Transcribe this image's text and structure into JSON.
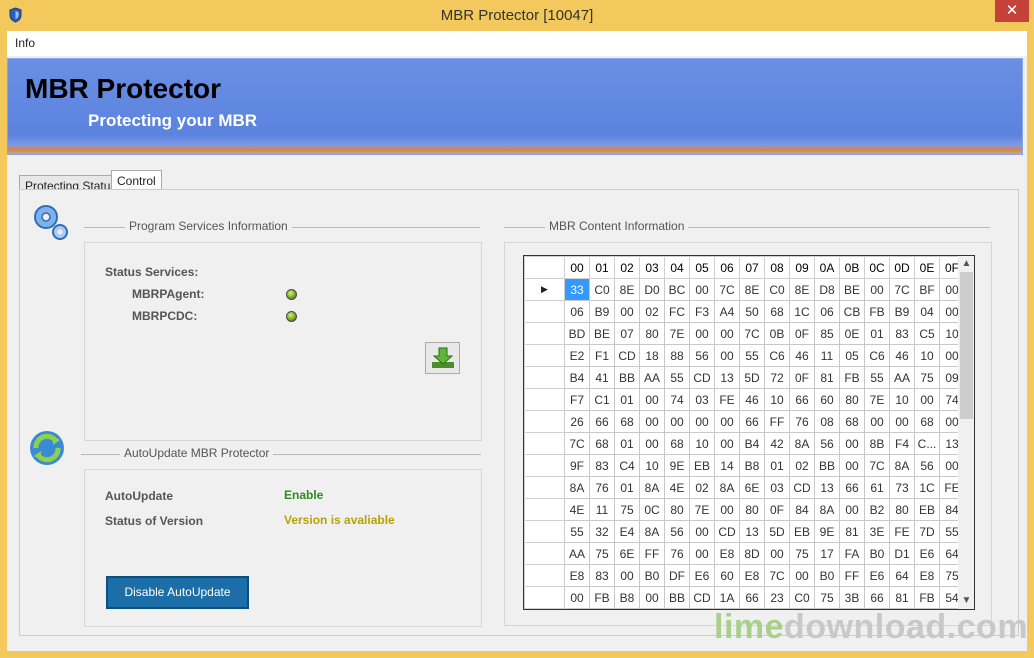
{
  "window": {
    "title": "MBR Protector [10047]",
    "close_glyph": "✕",
    "icon": "shield-icon"
  },
  "menu": {
    "items": [
      "Info"
    ]
  },
  "banner": {
    "title": "MBR Protector",
    "subtitle": "Protecting your MBR"
  },
  "tabs": [
    {
      "label": "Protecting Status",
      "active": false
    },
    {
      "label": "Control",
      "active": true
    }
  ],
  "services": {
    "group_title": "Program Services Information",
    "status_label": "Status Services:",
    "items": [
      {
        "name": "MBRPAgent:",
        "status": "running"
      },
      {
        "name": "MBRPCDC:",
        "status": "running"
      }
    ],
    "icon": "gears-icon"
  },
  "autoupdate": {
    "group_title": "AutoUpdate MBR Protector",
    "autoupdate_label": "AutoUpdate",
    "autoupdate_value": "Enable",
    "version_label": "Status of Version",
    "version_value": "Version is avaliable",
    "disable_button": "Disable AutoUpdate",
    "icon": "refresh-icon",
    "download_icon": "download-icon"
  },
  "mbr": {
    "group_title": "MBR Content Information",
    "columns": [
      "00",
      "01",
      "02",
      "03",
      "04",
      "05",
      "06",
      "07",
      "08",
      "09",
      "0A",
      "0B",
      "0C",
      "0D",
      "0E",
      "0F"
    ],
    "selected_row_marker": "▶",
    "rows": [
      [
        "33",
        "C0",
        "8E",
        "D0",
        "BC",
        "00",
        "7C",
        "8E",
        "C0",
        "8E",
        "D8",
        "BE",
        "00",
        "7C",
        "BF",
        "00"
      ],
      [
        "06",
        "B9",
        "00",
        "02",
        "FC",
        "F3",
        "A4",
        "50",
        "68",
        "1C",
        "06",
        "CB",
        "FB",
        "B9",
        "04",
        "00"
      ],
      [
        "BD",
        "BE",
        "07",
        "80",
        "7E",
        "00",
        "00",
        "7C",
        "0B",
        "0F",
        "85",
        "0E",
        "01",
        "83",
        "C5",
        "10"
      ],
      [
        "E2",
        "F1",
        "CD",
        "18",
        "88",
        "56",
        "00",
        "55",
        "C6",
        "46",
        "11",
        "05",
        "C6",
        "46",
        "10",
        "00"
      ],
      [
        "B4",
        "41",
        "BB",
        "AA",
        "55",
        "CD",
        "13",
        "5D",
        "72",
        "0F",
        "81",
        "FB",
        "55",
        "AA",
        "75",
        "09"
      ],
      [
        "F7",
        "C1",
        "01",
        "00",
        "74",
        "03",
        "FE",
        "46",
        "10",
        "66",
        "60",
        "80",
        "7E",
        "10",
        "00",
        "74"
      ],
      [
        "26",
        "66",
        "68",
        "00",
        "00",
        "00",
        "00",
        "66",
        "FF",
        "76",
        "08",
        "68",
        "00",
        "00",
        "68",
        "00"
      ],
      [
        "7C",
        "68",
        "01",
        "00",
        "68",
        "10",
        "00",
        "B4",
        "42",
        "8A",
        "56",
        "00",
        "8B",
        "F4",
        "C...",
        "13"
      ],
      [
        "9F",
        "83",
        "C4",
        "10",
        "9E",
        "EB",
        "14",
        "B8",
        "01",
        "02",
        "BB",
        "00",
        "7C",
        "8A",
        "56",
        "00"
      ],
      [
        "8A",
        "76",
        "01",
        "8A",
        "4E",
        "02",
        "8A",
        "6E",
        "03",
        "CD",
        "13",
        "66",
        "61",
        "73",
        "1C",
        "FE"
      ],
      [
        "4E",
        "11",
        "75",
        "0C",
        "80",
        "7E",
        "00",
        "80",
        "0F",
        "84",
        "8A",
        "00",
        "B2",
        "80",
        "EB",
        "84"
      ],
      [
        "55",
        "32",
        "E4",
        "8A",
        "56",
        "00",
        "CD",
        "13",
        "5D",
        "EB",
        "9E",
        "81",
        "3E",
        "FE",
        "7D",
        "55"
      ],
      [
        "AA",
        "75",
        "6E",
        "FF",
        "76",
        "00",
        "E8",
        "8D",
        "00",
        "75",
        "17",
        "FA",
        "B0",
        "D1",
        "E6",
        "64"
      ],
      [
        "E8",
        "83",
        "00",
        "B0",
        "DF",
        "E6",
        "60",
        "E8",
        "7C",
        "00",
        "B0",
        "FF",
        "E6",
        "64",
        "E8",
        "75"
      ],
      [
        "00",
        "FB",
        "B8",
        "00",
        "BB",
        "CD",
        "1A",
        "66",
        "23",
        "C0",
        "75",
        "3B",
        "66",
        "81",
        "FB",
        "54"
      ]
    ]
  },
  "watermark": {
    "part1": "lime",
    "part2": "download.com"
  }
}
